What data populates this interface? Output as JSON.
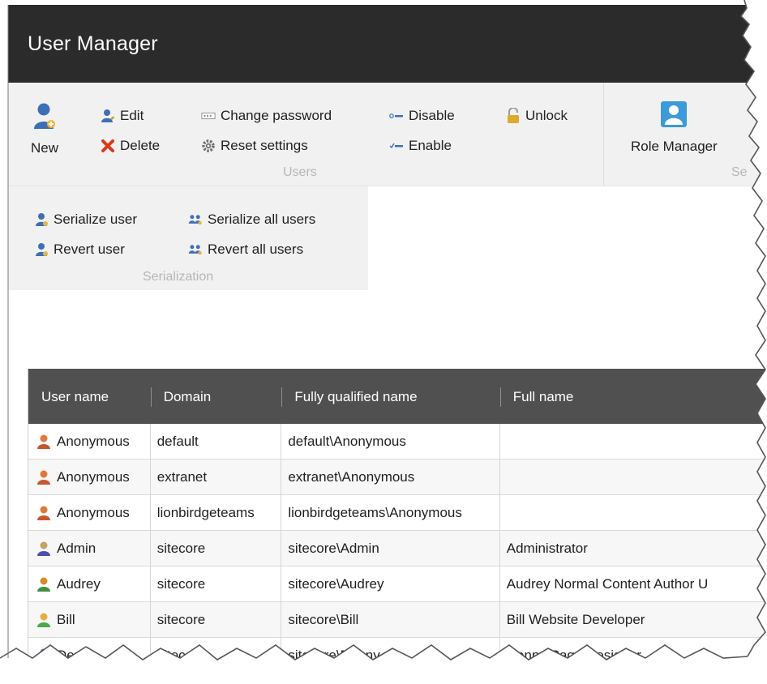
{
  "app": {
    "title": "User Manager"
  },
  "ribbon": {
    "users_group": {
      "label": "Users",
      "new_label": "New",
      "edit_label": "Edit",
      "delete_label": "Delete",
      "change_password_label": "Change password",
      "reset_settings_label": "Reset settings",
      "disable_label": "Disable",
      "enable_label": "Enable",
      "unlock_label": "Unlock"
    },
    "security_group": {
      "role_manager_label": "Role Manager",
      "label_partial": "Se"
    },
    "serialization_group": {
      "label": "Serialization",
      "serialize_user_label": "Serialize user",
      "revert_user_label": "Revert user",
      "serialize_all_label": "Serialize all users",
      "revert_all_label": "Revert all users"
    }
  },
  "grid": {
    "columns": [
      "User name",
      "Domain",
      "Fully qualified name",
      "Full name"
    ],
    "rows": [
      {
        "username": "Anonymous",
        "domain": "default",
        "fqn": "default\\Anonymous",
        "fullname": "",
        "icon": "anonymous-user-icon"
      },
      {
        "username": "Anonymous",
        "domain": "extranet",
        "fqn": "extranet\\Anonymous",
        "fullname": "",
        "icon": "anonymous-user-icon"
      },
      {
        "username": "Anonymous",
        "domain": "lionbirdgeteams",
        "fqn": "lionbirdgeteams\\Anonymous",
        "fullname": "",
        "icon": "anonymous-user-icon"
      },
      {
        "username": "Admin",
        "domain": "sitecore",
        "fqn": "sitecore\\Admin",
        "fullname": "Administrator",
        "icon": "admin-user-icon"
      },
      {
        "username": "Audrey",
        "domain": "sitecore",
        "fqn": "sitecore\\Audrey",
        "fullname": "Audrey Normal Content Author U",
        "icon": "female-user-icon"
      },
      {
        "username": "Bill",
        "domain": "sitecore",
        "fqn": "sitecore\\Bill",
        "fullname": "Bill Website Developer",
        "icon": "green-user-icon"
      },
      {
        "username": "Denny",
        "domain": "sitecore",
        "fqn": "sitecore\\Denny",
        "fullname": "Denny Page Designer",
        "icon": "red-user-icon"
      }
    ]
  },
  "colors": {
    "titlebar": "#2b2b2b",
    "ribbon": "#f1f1f1",
    "grid_header": "#505050",
    "delete_red": "#d93a1a",
    "user_blue": "#3d6fb6"
  }
}
